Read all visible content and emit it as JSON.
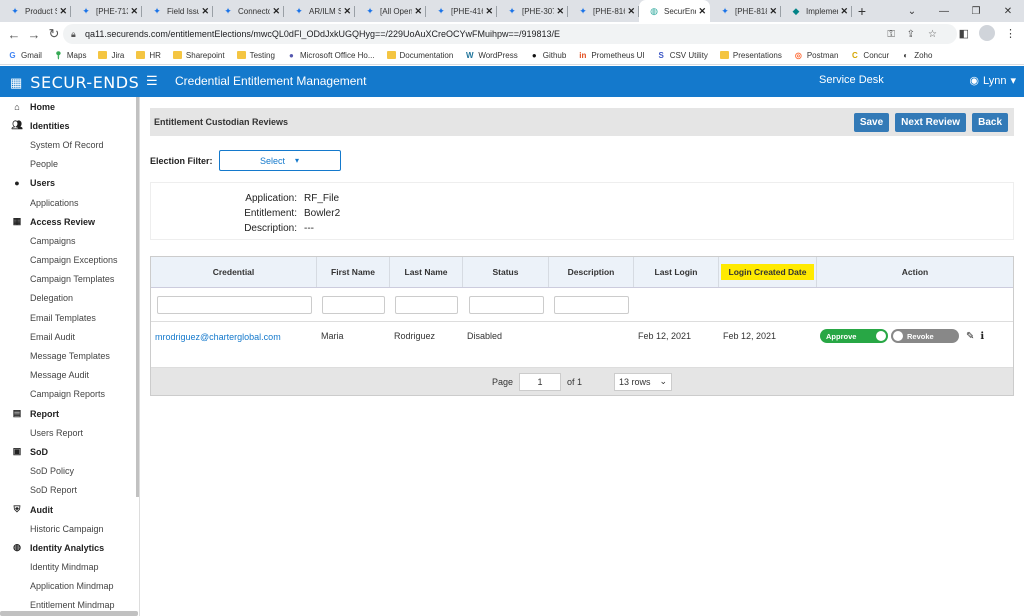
{
  "browser": {
    "tabs": [
      {
        "label": "Product S",
        "icon": "jira-icon"
      },
      {
        "label": "[PHE-713",
        "icon": "jira-icon"
      },
      {
        "label": "Field Issu",
        "icon": "jira-icon"
      },
      {
        "label": "Connecto",
        "icon": "jira-icon"
      },
      {
        "label": "AR/ILM Sc",
        "icon": "jira-icon"
      },
      {
        "label": "[All Open",
        "icon": "jira-icon"
      },
      {
        "label": "[PHE-416",
        "icon": "jira-icon"
      },
      {
        "label": "[PHE-307",
        "icon": "jira-icon"
      },
      {
        "label": "[PHE-816",
        "icon": "jira-icon"
      },
      {
        "label": "SecurEnds",
        "icon": "securends-icon",
        "active": true
      },
      {
        "label": "[PHE-818",
        "icon": "jira-icon"
      },
      {
        "label": "Implemen",
        "icon": "sharepoint-icon"
      }
    ],
    "url": "qa11.securends.com/entitlementElections/mwcQL0dFl_ODdJxkUGQHyg==/229UoAuXCreOCYwFMuihpw==/919813/E",
    "bookmarks": [
      "Gmail",
      "Maps",
      "Jira",
      "HR",
      "Sharepoint",
      "Testing",
      "Microsoft Office Ho...",
      "Documentation",
      "WordPress",
      "Github",
      "Prometheus UI",
      "CSV Utility",
      "Presentations",
      "Postman",
      "Concur",
      "Zoho"
    ]
  },
  "app": {
    "brand": "SECUR-ENDS",
    "title": "Credential Entitlement Management",
    "service_desk": "Service Desk",
    "user": "Lynn",
    "accent": "#1479cc"
  },
  "sidebar": {
    "items": [
      {
        "label": "Home",
        "type": "section",
        "icon": "home-icon"
      },
      {
        "label": "Identities",
        "type": "section",
        "icon": "users-icon"
      },
      {
        "label": "System Of Record",
        "type": "sub"
      },
      {
        "label": "People",
        "type": "sub"
      },
      {
        "label": "Users",
        "type": "section",
        "icon": "user-icon"
      },
      {
        "label": "Applications",
        "type": "sub"
      },
      {
        "label": "Access Review",
        "type": "section",
        "icon": "grid-icon"
      },
      {
        "label": "Campaigns",
        "type": "sub"
      },
      {
        "label": "Campaign Exceptions",
        "type": "sub"
      },
      {
        "label": "Campaign Templates",
        "type": "sub"
      },
      {
        "label": "Delegation",
        "type": "sub"
      },
      {
        "label": "Email Templates",
        "type": "sub"
      },
      {
        "label": "Email Audit",
        "type": "sub"
      },
      {
        "label": "Message Templates",
        "type": "sub"
      },
      {
        "label": "Message Audit",
        "type": "sub"
      },
      {
        "label": "Campaign Reports",
        "type": "sub"
      },
      {
        "label": "Report",
        "type": "section",
        "icon": "report-icon"
      },
      {
        "label": "Users Report",
        "type": "sub"
      },
      {
        "label": "SoD",
        "type": "section",
        "icon": "sod-icon"
      },
      {
        "label": "SoD Policy",
        "type": "sub"
      },
      {
        "label": "SoD Report",
        "type": "sub"
      },
      {
        "label": "Audit",
        "type": "section",
        "icon": "shield-icon"
      },
      {
        "label": "Historic Campaign",
        "type": "sub"
      },
      {
        "label": "Identity Analytics",
        "type": "section",
        "icon": "analytics-icon"
      },
      {
        "label": "Identity Mindmap",
        "type": "sub"
      },
      {
        "label": "Application Mindmap",
        "type": "sub"
      },
      {
        "label": "Entitlement Mindmap",
        "type": "sub"
      }
    ]
  },
  "panel": {
    "heading": "Entitlement Custodian Reviews",
    "buttons": {
      "save": "Save",
      "next_review": "Next Review",
      "back": "Back"
    },
    "filter_label": "Election Filter:",
    "filter_value": "Select"
  },
  "details": {
    "application_label": "Application:",
    "application": "RF_File",
    "entitlement_label": "Entitlement:",
    "entitlement": "Bowler2",
    "description_label": "Description:",
    "description": "---"
  },
  "table": {
    "headers": [
      "Credential",
      "First Name",
      "Last Name",
      "Status",
      "Description",
      "Last Login",
      "Login Created Date",
      "Action"
    ],
    "rows": [
      {
        "credential": "mrodriguez@charterglobal.com",
        "first_name": "Maria",
        "last_name": "Rodriguez",
        "status": "Disabled",
        "description": "",
        "last_login": "Feb 12, 2021",
        "login_created": "Feb 12, 2021",
        "approve": "Approve",
        "revoke": "Revoke"
      }
    ]
  },
  "pager": {
    "page_label": "Page",
    "page": "1",
    "of": "of 1",
    "rows": "13 rows"
  }
}
